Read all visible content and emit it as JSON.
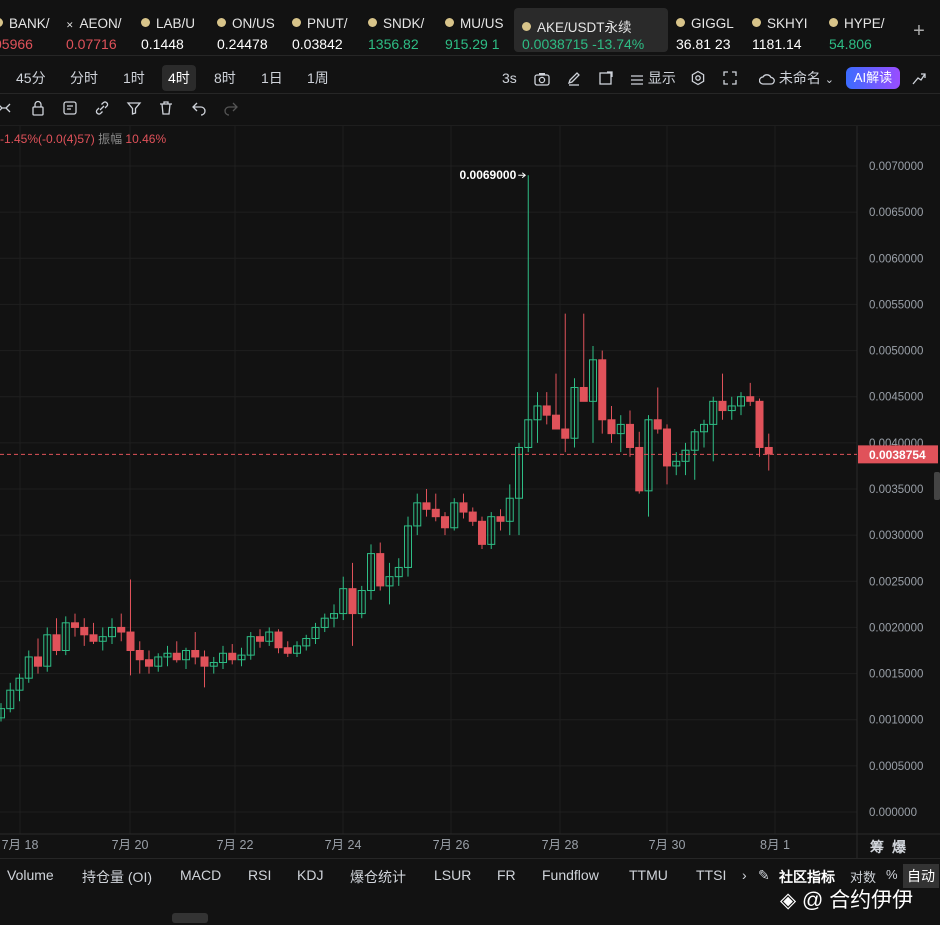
{
  "ticker": [
    {
      "name": "BANK/",
      "price": "05966",
      "price_color": "#e0525a",
      "icon": "coin-icon"
    },
    {
      "name": "AEON/",
      "price": "0.07716",
      "price_color": "#e0525a",
      "icon": "x-icon"
    },
    {
      "name": "LAB/U",
      "price": "0.1448",
      "price_color": "#ffffff",
      "icon": "coin-icon"
    },
    {
      "name": "ON/US",
      "price": "0.24478",
      "price_color": "#ffffff",
      "icon": "coin-icon"
    },
    {
      "name": "PNUT/",
      "price": "0.03842",
      "price_color": "#ffffff",
      "icon": "coin-icon"
    },
    {
      "name": "SNDK/",
      "price": "1356.82",
      "price_color": "#2ebd85",
      "icon": "coin-icon"
    },
    {
      "name": "MU/US",
      "price": "915.29  1",
      "price_color": "#2ebd85",
      "icon": "coin-icon"
    },
    {
      "name": "AKE/USDT永续",
      "price": "0.0038715  -13.74%",
      "price_color": "#2ebd85",
      "icon": "coin-icon",
      "active": true
    },
    {
      "name": "GIGGL",
      "price": "36.81  23",
      "price_color": "#ffffff",
      "icon": "coin-icon"
    },
    {
      "name": "SKHYI",
      "price": "1181.14",
      "price_color": "#ffffff",
      "icon": "coin-icon"
    },
    {
      "name": "HYPE/",
      "price": "54.806",
      "price_color": "#2ebd85",
      "icon": "coin-icon"
    }
  ],
  "intervals": {
    "items": [
      "45分",
      "分时",
      "1时",
      "4时",
      "8时",
      "1日",
      "1周"
    ],
    "active": "4时",
    "refresh": "3s",
    "display_label": "显示",
    "layout_name": "未命名",
    "ai_label": "AI解读"
  },
  "info_line": {
    "change": "-1.45%(-0.0(4)57)",
    "amplitude_label": "振幅",
    "amplitude_value": "10.46%"
  },
  "chart_data": {
    "type": "candlestick",
    "symbol": "AKE/USDT永续",
    "interval": "4时",
    "x_tick_labels": [
      "7月 18",
      "7月 20",
      "7月 22",
      "7月 24",
      "7月 26",
      "7月 28",
      "7月 30",
      "8月 1"
    ],
    "y_tick_labels": [
      "0.0070000",
      "0.0065000",
      "0.0060000",
      "0.0055000",
      "0.0050000",
      "0.0045000",
      "0.0040000",
      "0.0035000",
      "0.0030000",
      "0.0025000",
      "0.0020000",
      "0.0015000",
      "0.0010000",
      "0.0005000",
      "0.000000"
    ],
    "ylim": [
      0,
      0.007
    ],
    "last_price": "0.0038754",
    "last_price_value": 0.0038754,
    "high_marker": "0.0069000",
    "high_marker_value": 0.0069,
    "colors": {
      "up": "#2ebd85",
      "down": "#e0525a"
    },
    "candles": [
      [
        0.00102,
        0.00118,
        0.00098,
        0.00112
      ],
      [
        0.00112,
        0.0014,
        0.00108,
        0.00132
      ],
      [
        0.00132,
        0.0015,
        0.0012,
        0.00145
      ],
      [
        0.00145,
        0.00175,
        0.0014,
        0.00168
      ],
      [
        0.00168,
        0.00188,
        0.0015,
        0.00158
      ],
      [
        0.00158,
        0.002,
        0.00152,
        0.00192
      ],
      [
        0.00192,
        0.0021,
        0.0017,
        0.00175
      ],
      [
        0.00175,
        0.00212,
        0.0017,
        0.00205
      ],
      [
        0.00205,
        0.00215,
        0.0019,
        0.002
      ],
      [
        0.002,
        0.0021,
        0.0018,
        0.00192
      ],
      [
        0.00192,
        0.00205,
        0.00182,
        0.00185
      ],
      [
        0.00185,
        0.002,
        0.00175,
        0.0019
      ],
      [
        0.0019,
        0.0021,
        0.00182,
        0.002
      ],
      [
        0.002,
        0.00215,
        0.00185,
        0.00195
      ],
      [
        0.00195,
        0.00252,
        0.00148,
        0.00175
      ],
      [
        0.00175,
        0.00185,
        0.0015,
        0.00165
      ],
      [
        0.00165,
        0.00175,
        0.0015,
        0.00158
      ],
      [
        0.00158,
        0.00172,
        0.00152,
        0.00168
      ],
      [
        0.00168,
        0.0018,
        0.00158,
        0.00172
      ],
      [
        0.00172,
        0.00185,
        0.00162,
        0.00165
      ],
      [
        0.00165,
        0.00178,
        0.00155,
        0.00175
      ],
      [
        0.00175,
        0.00195,
        0.0016,
        0.00168
      ],
      [
        0.00168,
        0.00175,
        0.00135,
        0.00158
      ],
      [
        0.00158,
        0.00168,
        0.0015,
        0.00162
      ],
      [
        0.00162,
        0.0018,
        0.00155,
        0.00172
      ],
      [
        0.00172,
        0.00182,
        0.0016,
        0.00165
      ],
      [
        0.00165,
        0.00178,
        0.00158,
        0.0017
      ],
      [
        0.0017,
        0.00195,
        0.00165,
        0.0019
      ],
      [
        0.0019,
        0.00198,
        0.00178,
        0.00185
      ],
      [
        0.00185,
        0.002,
        0.0018,
        0.00195
      ],
      [
        0.00195,
        0.00198,
        0.00172,
        0.00178
      ],
      [
        0.00178,
        0.00185,
        0.00168,
        0.00172
      ],
      [
        0.00172,
        0.00185,
        0.00168,
        0.0018
      ],
      [
        0.0018,
        0.00192,
        0.00175,
        0.00188
      ],
      [
        0.00188,
        0.00205,
        0.00182,
        0.002
      ],
      [
        0.002,
        0.00215,
        0.00195,
        0.0021
      ],
      [
        0.0021,
        0.00225,
        0.002,
        0.00215
      ],
      [
        0.00215,
        0.00255,
        0.00208,
        0.00242
      ],
      [
        0.00242,
        0.0027,
        0.0018,
        0.00215
      ],
      [
        0.00215,
        0.00245,
        0.0021,
        0.0024
      ],
      [
        0.0024,
        0.0029,
        0.0023,
        0.0028
      ],
      [
        0.0028,
        0.00292,
        0.0024,
        0.00245
      ],
      [
        0.00245,
        0.0027,
        0.00225,
        0.00255
      ],
      [
        0.00255,
        0.00275,
        0.00245,
        0.00265
      ],
      [
        0.00265,
        0.0032,
        0.00255,
        0.0031
      ],
      [
        0.0031,
        0.00345,
        0.003,
        0.00335
      ],
      [
        0.00335,
        0.0035,
        0.0032,
        0.00328
      ],
      [
        0.00328,
        0.00345,
        0.00315,
        0.0032
      ],
      [
        0.0032,
        0.00325,
        0.003,
        0.00308
      ],
      [
        0.00308,
        0.0034,
        0.00305,
        0.00335
      ],
      [
        0.00335,
        0.00345,
        0.00318,
        0.00325
      ],
      [
        0.00325,
        0.0033,
        0.0031,
        0.00315
      ],
      [
        0.00315,
        0.0032,
        0.00285,
        0.0029
      ],
      [
        0.0029,
        0.00325,
        0.00285,
        0.0032
      ],
      [
        0.0032,
        0.00328,
        0.00305,
        0.00315
      ],
      [
        0.00315,
        0.00355,
        0.003,
        0.0034
      ],
      [
        0.0034,
        0.004,
        0.003,
        0.00395
      ],
      [
        0.00395,
        0.0069,
        0.0039,
        0.00425
      ],
      [
        0.00425,
        0.00455,
        0.004,
        0.0044
      ],
      [
        0.0044,
        0.00455,
        0.0042,
        0.0043
      ],
      [
        0.0043,
        0.00475,
        0.0042,
        0.00415
      ],
      [
        0.00415,
        0.0054,
        0.0039,
        0.00405
      ],
      [
        0.00405,
        0.0047,
        0.00395,
        0.0046
      ],
      [
        0.0046,
        0.0054,
        0.0045,
        0.00445
      ],
      [
        0.00445,
        0.00505,
        0.004,
        0.0049
      ],
      [
        0.0049,
        0.005,
        0.0041,
        0.00425
      ],
      [
        0.00425,
        0.0044,
        0.004,
        0.0041
      ],
      [
        0.0041,
        0.0043,
        0.0039,
        0.0042
      ],
      [
        0.0042,
        0.00435,
        0.00385,
        0.00395
      ],
      [
        0.00395,
        0.00412,
        0.00345,
        0.00348
      ],
      [
        0.00348,
        0.0043,
        0.0032,
        0.00425
      ],
      [
        0.00425,
        0.0046,
        0.0041,
        0.00415
      ],
      [
        0.00415,
        0.0042,
        0.00355,
        0.00375
      ],
      [
        0.00375,
        0.0039,
        0.00365,
        0.0038
      ],
      [
        0.0038,
        0.004,
        0.00365,
        0.00392
      ],
      [
        0.00392,
        0.00415,
        0.0036,
        0.00412
      ],
      [
        0.00412,
        0.00425,
        0.00395,
        0.0042
      ],
      [
        0.0042,
        0.0045,
        0.0038,
        0.00445
      ],
      [
        0.00445,
        0.00475,
        0.00425,
        0.00435
      ],
      [
        0.00435,
        0.0045,
        0.00425,
        0.0044
      ],
      [
        0.0044,
        0.00455,
        0.0043,
        0.0045
      ],
      [
        0.0045,
        0.00465,
        0.0044,
        0.00445
      ],
      [
        0.00445,
        0.00448,
        0.00385,
        0.00395
      ],
      [
        0.00395,
        0.0041,
        0.0037,
        0.00388
      ]
    ]
  },
  "indicators": {
    "items": [
      "Volume",
      "持仓量 (OI)",
      "MACD",
      "RSI",
      "KDJ",
      "爆仓统计",
      "LSUR",
      "FR",
      "Fundflow",
      "TTMU",
      "TTSI"
    ],
    "more": "›",
    "community": "社区指标",
    "log_label": "对数",
    "percent_label": "%",
    "auto_label": "自动"
  },
  "right_corner_labels": [
    "筹",
    "爆"
  ],
  "watermark": "@ 合约伊伊"
}
